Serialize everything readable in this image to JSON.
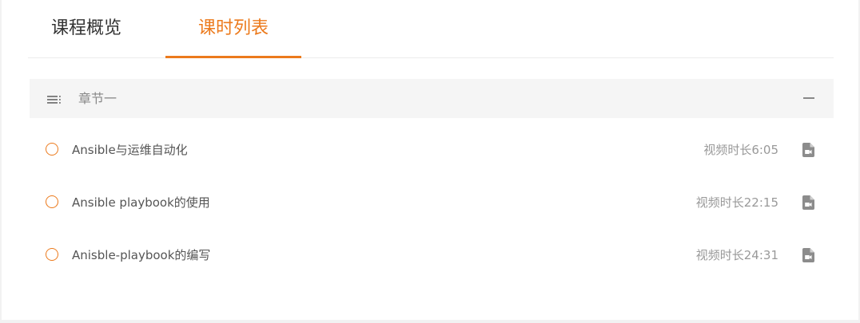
{
  "tabs": [
    {
      "label": "课程概览",
      "active": false
    },
    {
      "label": "课时列表",
      "active": true
    }
  ],
  "accent_color": "#ec7a1c",
  "chapter": {
    "title": "章节一",
    "icon": "list-menu-icon",
    "collapse_icon": "minus-icon"
  },
  "lessons": [
    {
      "title": "Ansible与运维自动化",
      "duration": "视频时长6:05",
      "icon": "video-file-icon"
    },
    {
      "title": "Ansible playbook的使用",
      "duration": "视频时长22:15",
      "icon": "video-file-icon"
    },
    {
      "title": "Anisble-playbook的编写",
      "duration": "视频时长24:31",
      "icon": "video-file-icon"
    }
  ]
}
